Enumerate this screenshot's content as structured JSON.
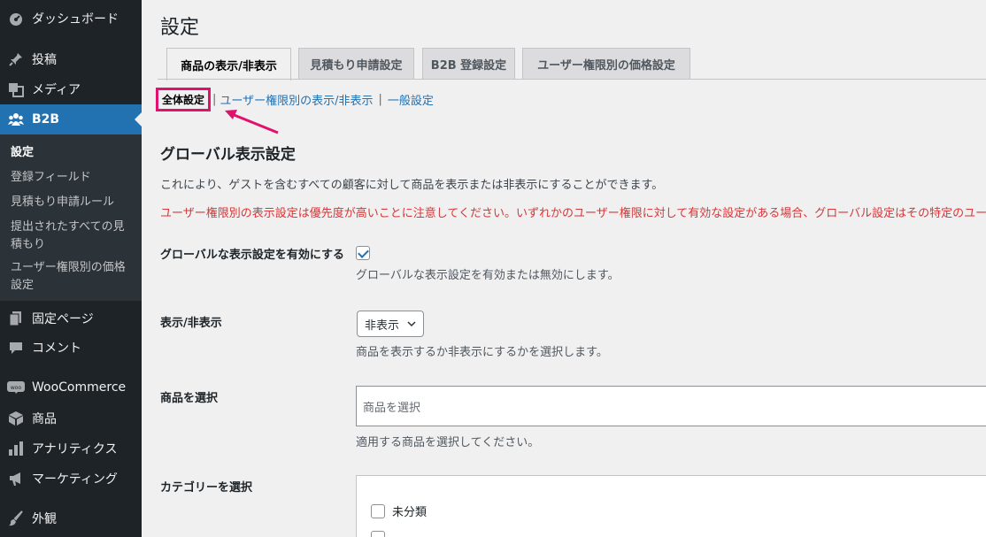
{
  "sidebar": {
    "items": [
      {
        "label": "ダッシュボード",
        "icon": "dashboard-icon"
      },
      {
        "label": "投稿",
        "icon": "pin-icon"
      },
      {
        "label": "メディア",
        "icon": "media-icon"
      },
      {
        "label": "B2B",
        "icon": "group-icon"
      },
      {
        "label": "固定ページ",
        "icon": "page-icon"
      },
      {
        "label": "コメント",
        "icon": "comment-icon"
      },
      {
        "label": "WooCommerce",
        "icon": "woo-icon"
      },
      {
        "label": "商品",
        "icon": "box-icon"
      },
      {
        "label": "アナリティクス",
        "icon": "bar-chart-icon"
      },
      {
        "label": "マーケティング",
        "icon": "megaphone-icon"
      },
      {
        "label": "外観",
        "icon": "brush-icon"
      }
    ],
    "submenu": [
      {
        "label": "設定"
      },
      {
        "label": "登録フィールド"
      },
      {
        "label": "見積もり申請ルール"
      },
      {
        "label": "提出されたすべての見積もり"
      },
      {
        "label": "ユーザー権限別の価格設定"
      }
    ]
  },
  "page_title": "設定",
  "tabs": [
    {
      "label": "商品の表示/非表示"
    },
    {
      "label": "見積もり申請設定"
    },
    {
      "label": "B2B 登録設定"
    },
    {
      "label": "ユーザー権限別の価格設定"
    }
  ],
  "subnav": {
    "current": "全体設定",
    "link1": "ユーザー権限別の表示/非表示",
    "sep": "|",
    "link2": "一般設定"
  },
  "section": {
    "title": "グローバル表示設定",
    "desc": "これにより、ゲストを含むすべての顧客に対して商品を表示または非表示にすることができます。",
    "warning": "ユーザー権限別の表示設定は優先度が高いことに注意してください。いずれかのユーザー権限に対して有効な設定がある場合、グローバル設定はその特定のユー"
  },
  "fields": {
    "enable": {
      "label": "グローバルな表示設定を有効にする",
      "help": "グローバルな表示設定を有効または無効にします。",
      "checked": true
    },
    "visibility": {
      "label": "表示/非表示",
      "value": "非表示",
      "help": "商品を表示するか非表示にするかを選択します。"
    },
    "products": {
      "label": "商品を選択",
      "placeholder": "商品を選択",
      "help": "適用する商品を選択してください。"
    },
    "categories": {
      "label": "カテゴリーを選択",
      "items": [
        "未分類"
      ]
    }
  },
  "colors": {
    "sidebar_bg": "#1d2327",
    "active": "#2271b1",
    "highlight": "#e1126e",
    "warning": "#d63638"
  }
}
